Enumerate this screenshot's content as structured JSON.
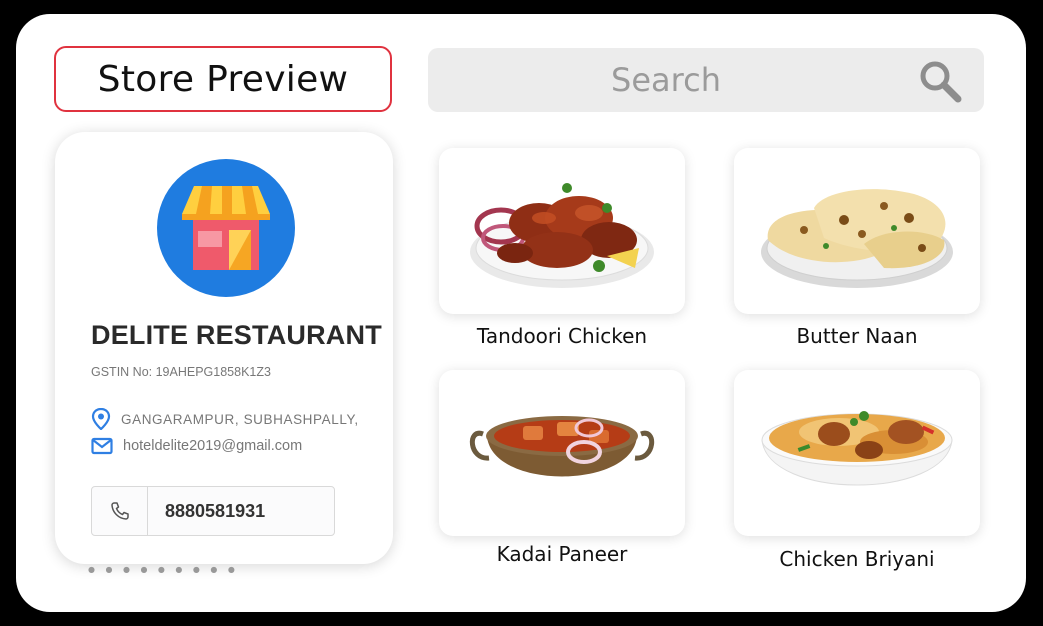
{
  "header": {
    "title": "Store Preview"
  },
  "search": {
    "placeholder": "Search"
  },
  "store": {
    "name": "DELITE RESTAURANT",
    "gstin": "GSTIN No: 19AHEPG1858K1Z3",
    "address": "GANGARAMPUR, SUBHASHPALLY,",
    "email": "hoteldelite2019@gmail.com",
    "phone": "8880581931"
  },
  "menu": {
    "items": [
      {
        "name": "Tandoori Chicken"
      },
      {
        "name": "Butter Naan"
      },
      {
        "name": "Kadai Paneer"
      },
      {
        "name": "Chicken Briyani"
      }
    ]
  },
  "colors": {
    "accent": "#e0323f",
    "logo_bg": "#1f7ce0",
    "icon_blue": "#2f7fe3"
  }
}
